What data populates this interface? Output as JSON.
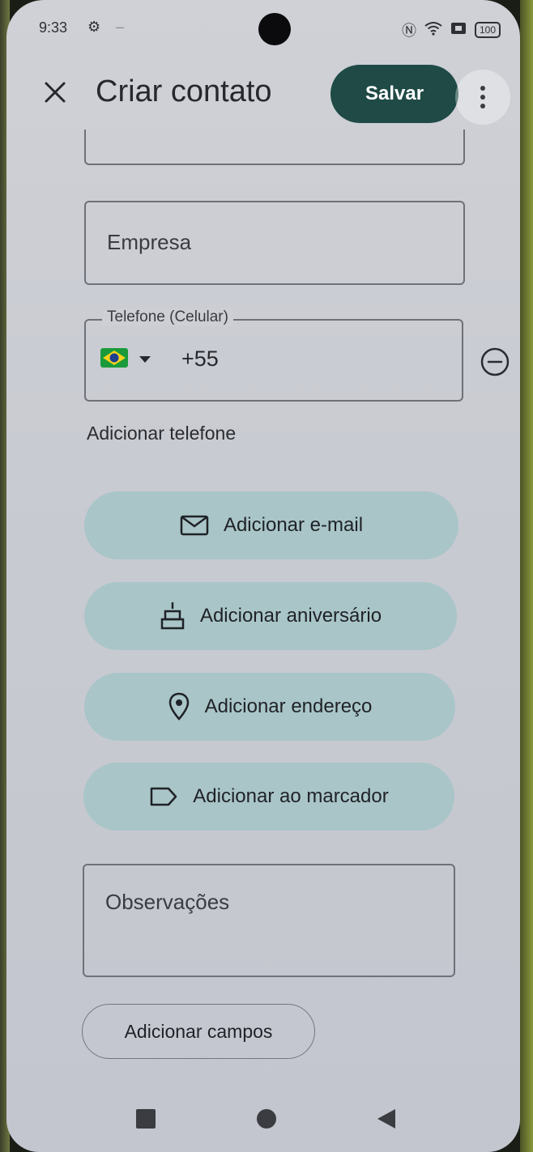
{
  "status": {
    "time": "9:33",
    "battery": "100",
    "icons": [
      "nfc-icon",
      "wifi-icon",
      "sim-icon"
    ]
  },
  "header": {
    "title": "Criar contato",
    "save_label": "Salvar",
    "close_icon": "close-icon",
    "more_icon": "more-vert-icon"
  },
  "fields": {
    "company_placeholder": "Empresa",
    "phone_label": "Telefone (Celular)",
    "phone_country_flag": "brazil-flag-icon",
    "phone_value": "+55",
    "notes_placeholder": "Observações"
  },
  "actions": {
    "add_phone": "Adicionar telefone",
    "add_email": "Adicionar e-mail",
    "add_birthday": "Adicionar aniversário",
    "add_address": "Adicionar endereço",
    "add_label": "Adicionar ao marcador",
    "add_fields": "Adicionar campos"
  },
  "colors": {
    "save_bg": "#1f4a46",
    "pill_bg": "#a9c5c8",
    "background": "#cdcfd5"
  }
}
